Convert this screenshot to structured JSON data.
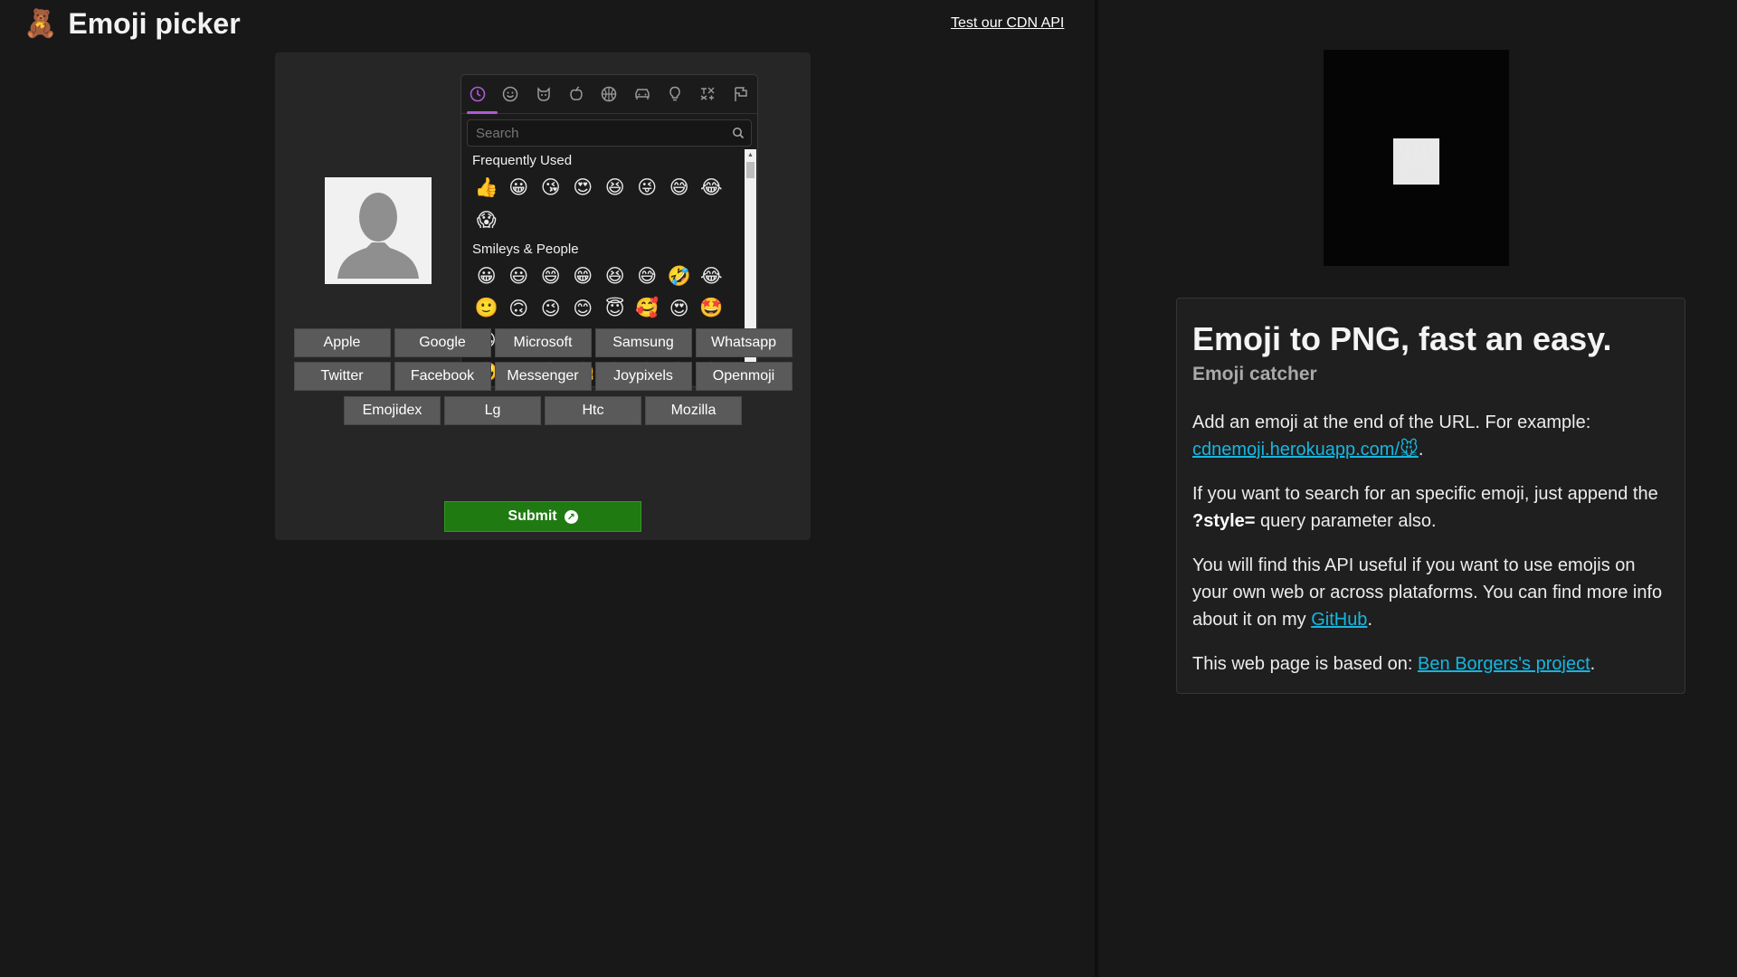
{
  "header": {
    "logo_icon": "🧸",
    "title": "Emoji picker",
    "cdn_link": "Test our CDN API"
  },
  "picker": {
    "categories": [
      "recent-icon",
      "smileys-icon",
      "animals-icon",
      "food-icon",
      "activity-icon",
      "travel-icon",
      "objects-icon",
      "symbols-icon",
      "flags-icon"
    ],
    "search_placeholder": "Search",
    "sections": [
      {
        "label": "Frequently Used",
        "emojis": [
          "👍",
          "😀",
          "😘",
          "😍",
          "😆",
          "😜",
          "😅",
          "😂",
          "😱"
        ]
      },
      {
        "label": "Smileys & People",
        "emojis": [
          "😀",
          "😃",
          "😄",
          "😁",
          "😆",
          "😅",
          "🤣",
          "😂",
          "🙂",
          "🙃",
          "😉",
          "😊",
          "😇",
          "🥰",
          "😍",
          "🤩",
          "😘",
          "😗",
          "☺️",
          "😚",
          "😙",
          "😋",
          "😛",
          "😜",
          "🤪",
          "😝",
          "🤑",
          "🤗",
          "🤭",
          "🤫",
          "🤔",
          "🤐"
        ]
      }
    ]
  },
  "styles": {
    "row1": [
      "Apple",
      "Google",
      "Microsoft",
      "Samsung",
      "Whatsapp"
    ],
    "row2": [
      "Twitter",
      "Facebook",
      "Messenger",
      "Joypixels",
      "Openmoji"
    ],
    "row3": [
      "Emojidex",
      "Lg",
      "Htc",
      "Mozilla"
    ],
    "submit": "Submit"
  },
  "preview": {
    "emoji": "🐭"
  },
  "info": {
    "heading": "Emoji to PNG, fast an easy.",
    "subheading": "Emoji catcher",
    "p1_text": "Add an emoji at the end of the URL. For example:",
    "p1_link": "cdnemoji.herokuapp.com/🐭",
    "p1_end": ".",
    "p2_pre": "If you want to search for an specific emoji, just append the ",
    "p2_bold": "?style=",
    "p2_post": " query parameter also.",
    "p3_text": "You will find this API useful if you want to use emojis on your own web or across plataforms. You can find more info about it on my ",
    "p3_link": "GitHub",
    "p3_end": ".",
    "p4_text": "This web page is based on: ",
    "p4_link": "Ben Borgers's project",
    "p4_end": "."
  },
  "colors": {
    "background": "#181818",
    "accent_link": "#17b6e0",
    "submit_green": "#1f7a12",
    "tab_indicator": "#b05ad6"
  }
}
